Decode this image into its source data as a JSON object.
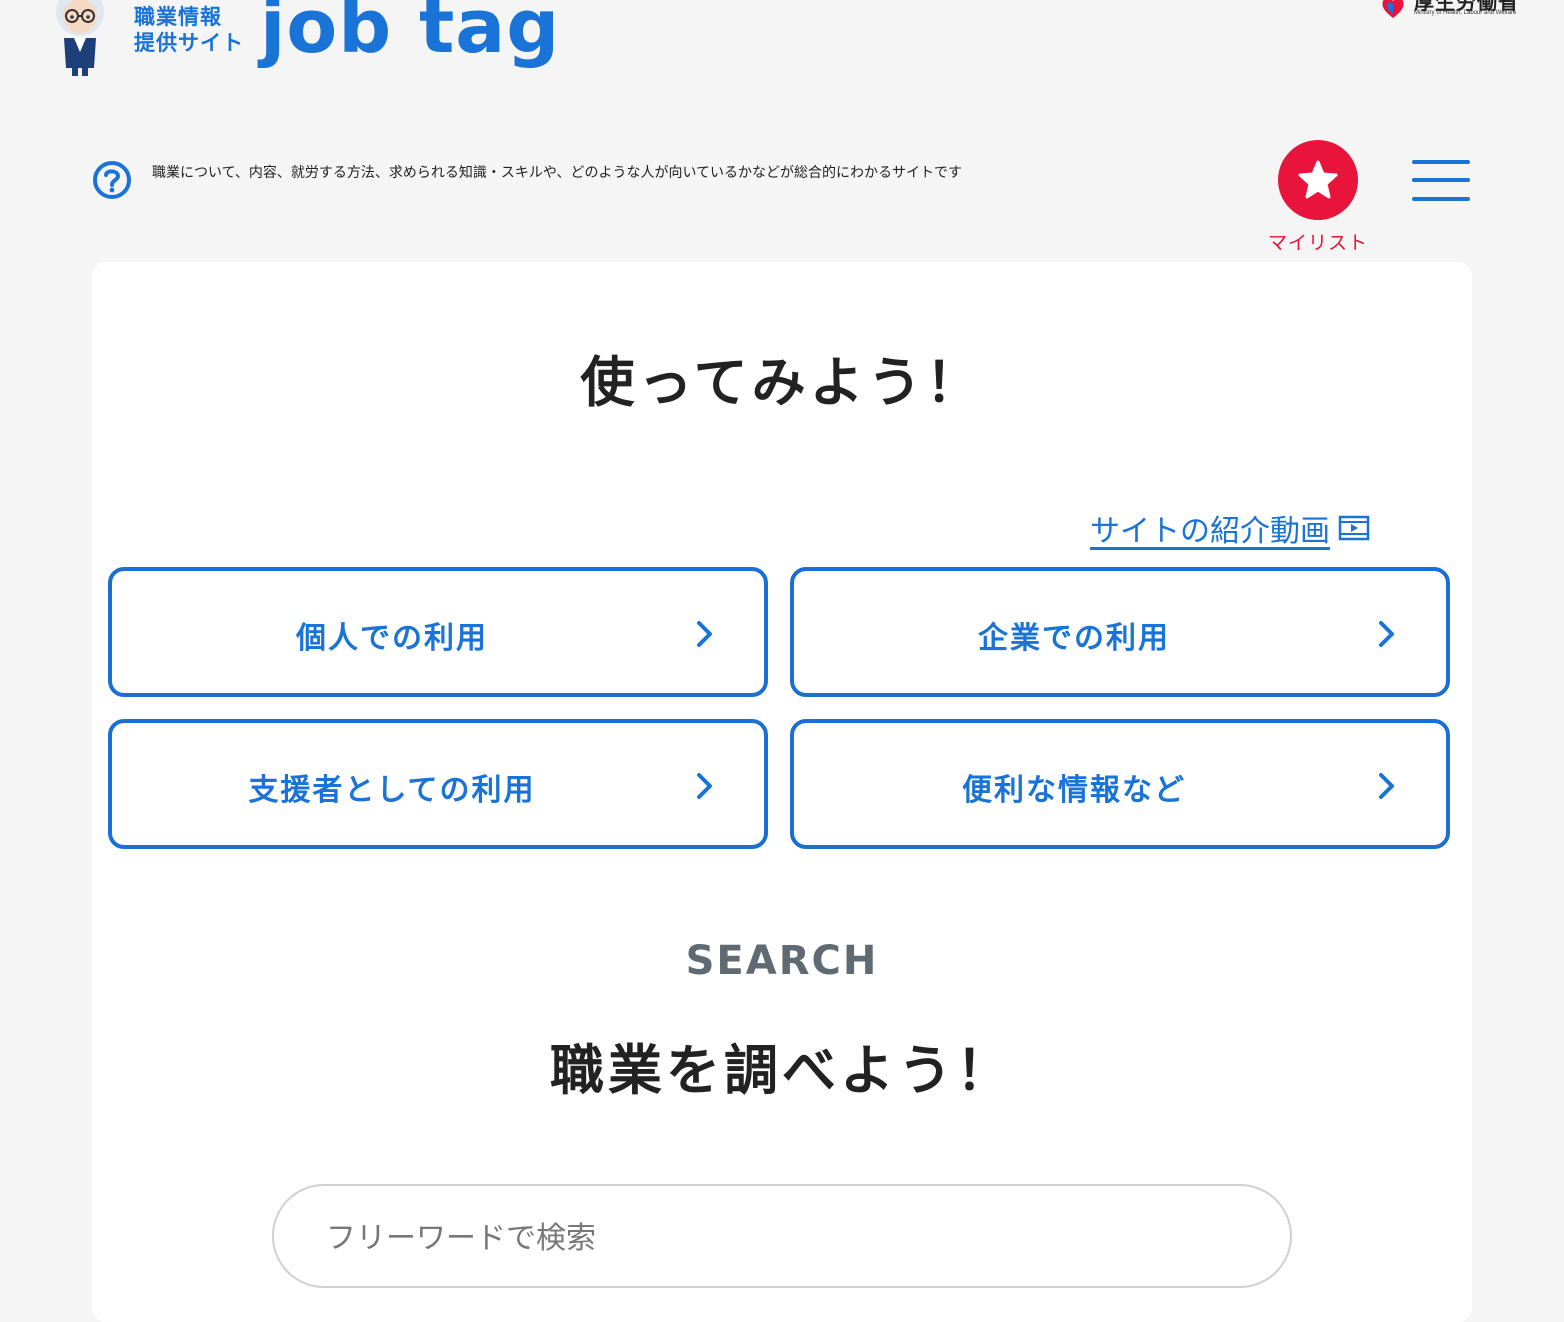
{
  "header": {
    "logo_sub_line1": "職業情報",
    "logo_sub_line2": "提供サイト",
    "logo_main": "job tag",
    "ministry_name": "厚生労働省",
    "ministry_en": "Ministry of Health, Labour and Welfare"
  },
  "intro": {
    "description": "職業について、内容、就労する方法、求められる知識・スキルや、どのような人が向いているかなどが総合的にわかるサイトです",
    "mylist_label": "マイリスト"
  },
  "usage": {
    "title": "使ってみよう！",
    "video_link": "サイトの紹介動画",
    "buttons": [
      {
        "label": "個人での利用"
      },
      {
        "label": "企業での利用"
      },
      {
        "label": "支援者としての利用"
      },
      {
        "label": "便利な情報など"
      }
    ]
  },
  "search": {
    "eyebrow": "SEARCH",
    "title": "職業を調べよう！",
    "placeholder": "フリーワードで検索",
    "value": ""
  },
  "colors": {
    "accent": "#1a73d6",
    "mylist": "#e8143c",
    "background": "#f5f5f5"
  },
  "icons": [
    "mascot-icon",
    "help-icon",
    "star-icon",
    "menu-icon",
    "video-icon",
    "chevron-right-icon"
  ]
}
